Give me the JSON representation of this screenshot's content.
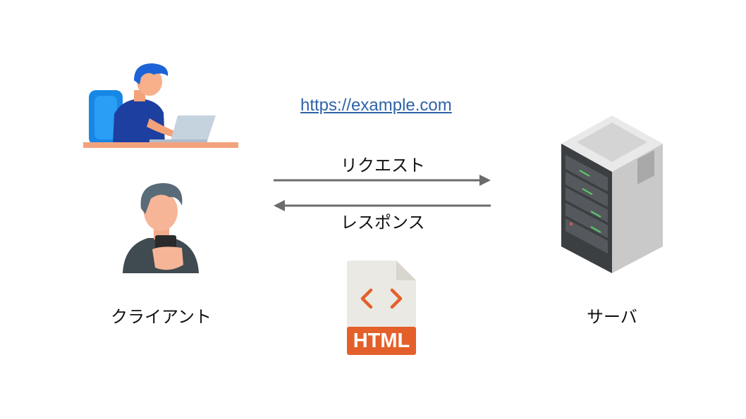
{
  "diagram": {
    "client_label": "クライアント",
    "server_label": "サーバ",
    "url": "https://example.com",
    "request_label": "リクエスト",
    "response_label": "レスポンス",
    "document_label": "HTML",
    "document_code_glyph": "< >"
  },
  "icons": {
    "client_laptop": "person-at-laptop-icon",
    "client_phone": "person-with-smartphone-icon",
    "server": "server-rack-icon",
    "document": "html-file-icon"
  },
  "colors": {
    "arrow": "#6b6b6b",
    "link": "#2f63a8",
    "html_accent": "#e4602b",
    "file_body": "#ebe9e3"
  }
}
